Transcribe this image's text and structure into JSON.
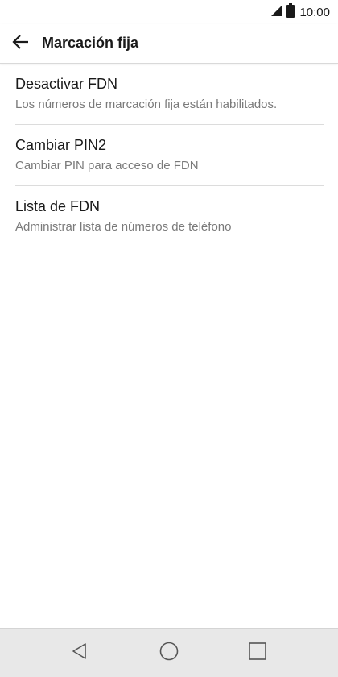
{
  "status_bar": {
    "time": "10:00",
    "icons": [
      "signal-icon",
      "battery-icon"
    ]
  },
  "header": {
    "title": "Marcación fija",
    "back_icon": "back-arrow-icon"
  },
  "items": [
    {
      "title": "Desactivar FDN",
      "subtitle": "Los números de marcación fija están habilitados."
    },
    {
      "title": "Cambiar PIN2",
      "subtitle": "Cambiar PIN para acceso de FDN"
    },
    {
      "title": "Lista de FDN",
      "subtitle": "Administrar lista de números de teléfono"
    }
  ],
  "nav_bar": {
    "buttons": [
      "back-triangle-icon",
      "home-circle-icon",
      "recents-square-icon"
    ]
  },
  "colors": {
    "background": "#ffffff",
    "primary_text": "#1a1a1a",
    "secondary_text": "#7a7a7a",
    "divider": "#dcdcdc",
    "nav_bar": "#e8e8e8"
  }
}
